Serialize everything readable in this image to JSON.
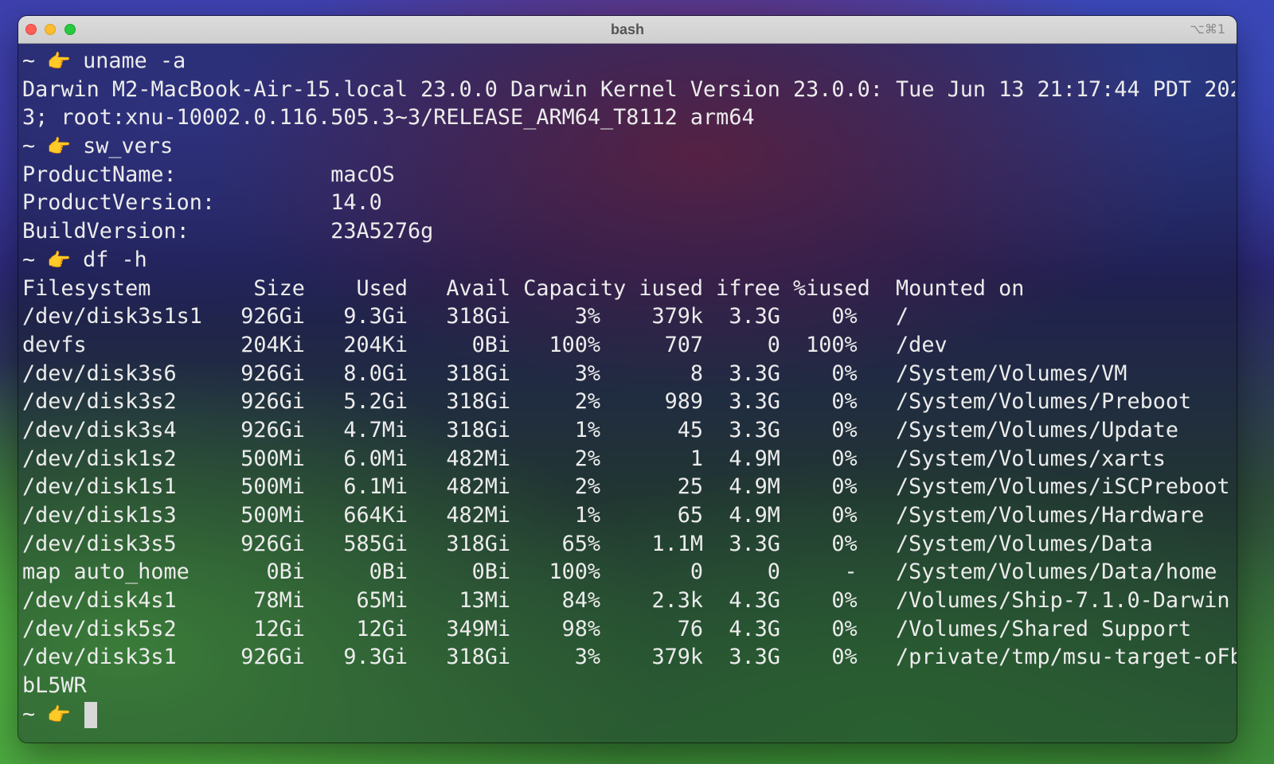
{
  "window": {
    "title": "bash",
    "shortcut": "⌥⌘1"
  },
  "terminal": {
    "prompt_symbol": "~",
    "prompt_icon": "pointing-finger-icon",
    "commands": [
      {
        "command": "uname -a",
        "output": [
          "Darwin M2-MacBook-Air-15.local 23.0.0 Darwin Kernel Version 23.0.0: Tue Jun 13 21:17:44 PDT 202",
          "3; root:xnu-10002.0.116.505.3~3/RELEASE_ARM64_T8112 arm64"
        ]
      },
      {
        "command": "sw_vers",
        "output": [
          "ProductName:            macOS",
          "ProductVersion:         14.0",
          "BuildVersion:           23A5276g"
        ]
      },
      {
        "command": "df -h",
        "output": [
          "Filesystem        Size    Used   Avail Capacity iused ifree %iused  Mounted on",
          "/dev/disk3s1s1   926Gi   9.3Gi   318Gi     3%    379k  3.3G    0%   /",
          "devfs            204Ki   204Ki     0Bi   100%     707     0  100%   /dev",
          "/dev/disk3s6     926Gi   8.0Gi   318Gi     3%       8  3.3G    0%   /System/Volumes/VM",
          "/dev/disk3s2     926Gi   5.2Gi   318Gi     2%     989  3.3G    0%   /System/Volumes/Preboot",
          "/dev/disk3s4     926Gi   4.7Mi   318Gi     1%      45  3.3G    0%   /System/Volumes/Update",
          "/dev/disk1s2     500Mi   6.0Mi   482Mi     2%       1  4.9M    0%   /System/Volumes/xarts",
          "/dev/disk1s1     500Mi   6.1Mi   482Mi     2%      25  4.9M    0%   /System/Volumes/iSCPreboot",
          "/dev/disk1s3     500Mi   664Ki   482Mi     1%      65  4.9M    0%   /System/Volumes/Hardware",
          "/dev/disk3s5     926Gi   585Gi   318Gi    65%    1.1M  3.3G    0%   /System/Volumes/Data",
          "map auto_home      0Bi     0Bi     0Bi   100%       0     0     -   /System/Volumes/Data/home",
          "/dev/disk4s1      78Mi    65Mi    13Mi    84%    2.3k  4.3G    0%   /Volumes/Ship-7.1.0-Darwin",
          "/dev/disk5s2      12Gi    12Gi   349Mi    98%      76  4.3G    0%   /Volumes/Shared Support",
          "/dev/disk3s1     926Gi   9.3Gi   318Gi     3%    379k  3.3G    0%   /private/tmp/msu-target-oFb",
          "bL5WR"
        ]
      }
    ],
    "final_prompt": ""
  }
}
